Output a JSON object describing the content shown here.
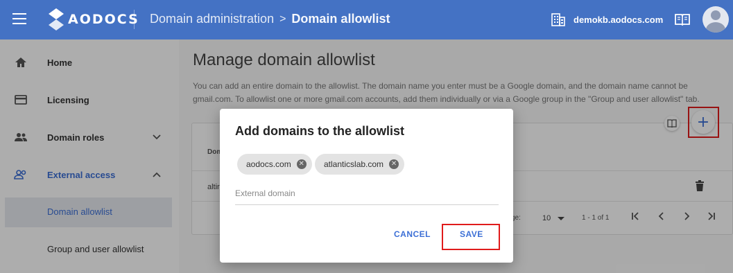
{
  "header": {
    "logo_text": "AODOCS",
    "breadcrumb_parent": "Domain administration",
    "breadcrumb_separator": ">",
    "breadcrumb_current": "Domain allowlist",
    "domain": "demokb.aodocs.com",
    "icons": [
      "menu-icon",
      "aodocs-logo",
      "building-icon",
      "book-icon",
      "avatar"
    ]
  },
  "sidebar": {
    "items": [
      {
        "label": "Home",
        "icon": "home-icon"
      },
      {
        "label": "Licensing",
        "icon": "card-icon"
      },
      {
        "label": "Domain roles",
        "icon": "people-icon",
        "expanded": false
      },
      {
        "label": "External access",
        "icon": "people-icon",
        "expanded": true
      }
    ],
    "sub_items": [
      {
        "label": "Domain allowlist",
        "active": true
      },
      {
        "label": "Group and user allowlist",
        "active": false
      }
    ]
  },
  "main": {
    "title": "Manage domain allowlist",
    "description": "You can add an entire domain to the allowlist. The domain name you enter must be a Google domain, and the domain name cannot be gmail.com. To allowlist one or more gmail.com accounts, add them individually or via a Google group in the \"Group and user allowlist\" tab.",
    "table": {
      "column_header": "Dom",
      "row_value": "altir"
    },
    "pagination": {
      "rows_label": "ge:",
      "page_size": "10",
      "range": "1 - 1 of 1"
    }
  },
  "dialog": {
    "title": "Add domains to the allowlist",
    "chips": [
      "aodocs.com",
      "atlanticslab.com"
    ],
    "input_placeholder": "External domain",
    "input_value": "",
    "cancel_label": "CANCEL",
    "save_label": "SAVE"
  },
  "colors": {
    "header_bg": "#4472c4",
    "accent": "#3c6fd6",
    "highlight": "#e01b1b"
  }
}
